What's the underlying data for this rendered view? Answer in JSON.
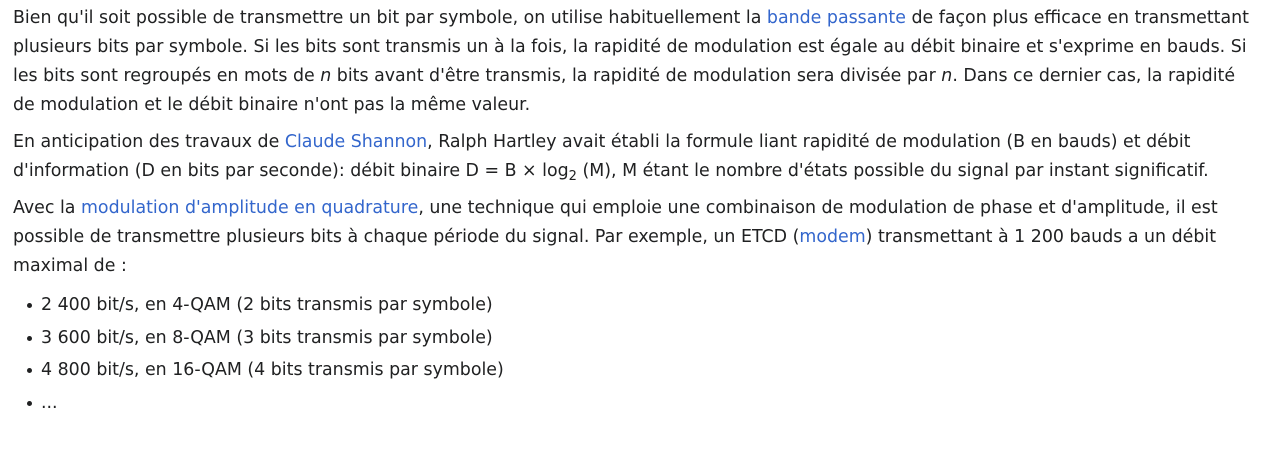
{
  "para1": {
    "t1": "Bien qu'il soit possible de transmettre un bit par symbole, on utilise habituellement la ",
    "link_bande": "bande passante",
    "t2": " de façon plus efficace en transmettant plusieurs bits par symbole. Si les bits sont transmis un à la fois, la rapidité de modulation est égale au débit binaire et s'exprime en bauds. Si les bits sont regroupés en mots de ",
    "n1": "n",
    "t3": " bits avant d'être transmis, la rapidité de modulation sera divisée par ",
    "n2": "n",
    "t4": ". Dans ce dernier cas, la rapidité de modulation et le débit binaire n'ont pas la même valeur."
  },
  "para2": {
    "t1": "En anticipation des travaux de ",
    "link_shannon": "Claude Shannon",
    "t2": ", Ralph Hartley avait établi la formule liant rapidité de modulation (B en bauds) et débit d'information (D en bits par seconde): débit binaire D = B × log",
    "sub": "2",
    "t3": " (M), M étant le nombre d'états possible du signal par instant significatif."
  },
  "para3": {
    "t1": "Avec la ",
    "link_qam": "modulation d'amplitude en quadrature",
    "t2": ", une technique qui emploie une combinaison de modulation de phase et d'amplitude, il est possible de transmettre plusieurs bits à chaque période du signal. Par exemple, un ETCD (",
    "link_modem": "modem",
    "t3": ") transmettant à 1 200 bauds a un débit maximal de :"
  },
  "list": {
    "items": [
      "2 400 bit/s, en 4-QAM (2 bits transmis par symbole)",
      "3 600 bit/s, en 8-QAM (3 bits transmis par symbole)",
      "4 800 bit/s, en 16-QAM (4 bits transmis par symbole)",
      "..."
    ]
  },
  "colors": {
    "text": "#202122",
    "link": "#3366cc",
    "background": "#ffffff"
  }
}
